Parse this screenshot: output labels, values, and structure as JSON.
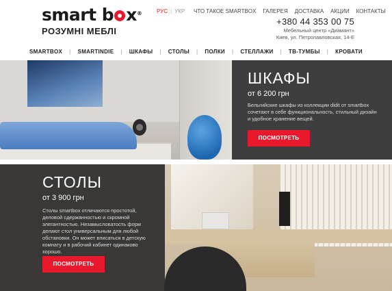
{
  "brand": {
    "logo_pre": "smart b",
    "logo_post": "x",
    "registered": "®",
    "tagline": "РОЗУМНІ МЕБЛІ",
    "accent_color": "#e8192c"
  },
  "lang": {
    "active": "РУС",
    "other": "УКР"
  },
  "topnav": [
    "ЧТО ТАКОЕ SMARTBOX",
    "ГАЛЕРЕЯ",
    "ДОСТАВКА",
    "АКЦИИ",
    "КОНТАКТЫ"
  ],
  "contact": {
    "phone": "+380 44 353 00 75",
    "address_line1": "Мебельный центр «Диамант»",
    "address_line2": "Киев, ул. Петропавловская, 14-Е"
  },
  "mainnav": [
    "SMARTBOX",
    "SMARTINDIE",
    "ШКАФЫ",
    "СТОЛЫ",
    "ПОЛКИ",
    "СТЕЛЛАЖИ",
    "ТВ-ТУМБЫ",
    "КРОВАТИ"
  ],
  "banner1": {
    "title": "ШКАФЫ",
    "price": "от 6 200 грн",
    "text": "Бельгийские шкафы из коллекции didit от smartbox сочетают в себе функциональность, стильный дизайн и удобное хранение вещей.",
    "button": "ПОСМОТРЕТЬ"
  },
  "banner2": {
    "title": "СТОЛЫ",
    "price": "от 3 900 грн",
    "text": "Столы smartbox отличаются простотой, деловой сдержанностью и скромной элегантностью. Незамысловатость форм делают стол универсальным для любой обстановки. Он может вписаться в детскую комнату и в рабочий кабинет одинаково хорошо.",
    "button": "ПОСМОТРЕТЬ"
  }
}
